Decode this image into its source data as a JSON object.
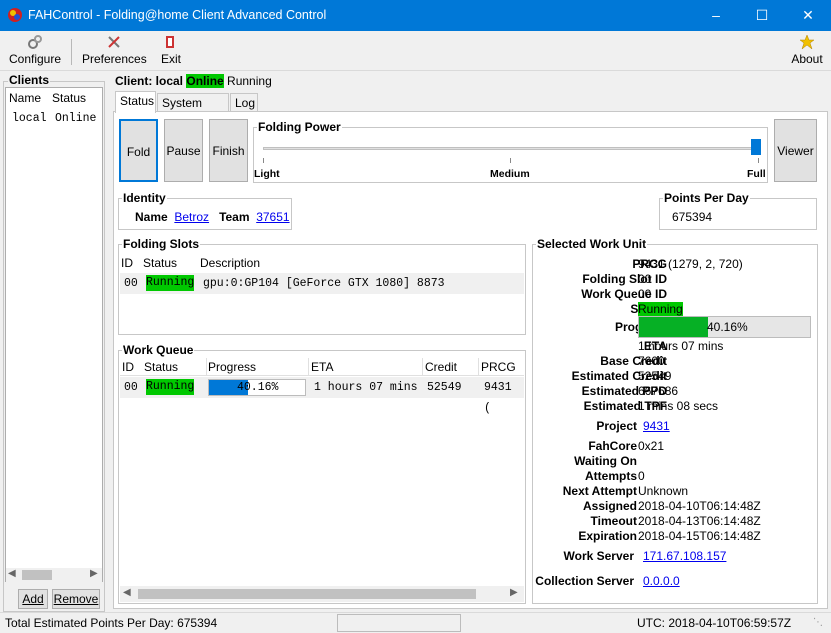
{
  "window": {
    "title": "FAHControl - Folding@home Client Advanced Control"
  },
  "toolbar": {
    "configure": "Configure",
    "preferences": "Preferences",
    "exit": "Exit",
    "about": "About"
  },
  "clients": {
    "title": "Clients",
    "col_name": "Name",
    "col_status": "Status",
    "rows": [
      {
        "name": "local",
        "status": "Online"
      }
    ],
    "add": "Add",
    "remove": "Remove"
  },
  "client_header": {
    "label": "Client: local",
    "status": "Online",
    "state": "Running"
  },
  "tabs": [
    "Status",
    "System Info",
    "Log"
  ],
  "controls": {
    "fold": "Fold",
    "pause": "Pause",
    "finish": "Finish",
    "viewer": "Viewer"
  },
  "folding_power": {
    "title": "Folding Power",
    "light": "Light",
    "medium": "Medium",
    "full": "Full",
    "level": 1.0
  },
  "identity": {
    "title": "Identity",
    "name_label": "Name",
    "name": "Betroz",
    "team_label": "Team",
    "team": "37651"
  },
  "ppd": {
    "title": "Points Per Day",
    "value": "675394"
  },
  "folding_slots": {
    "title": "Folding Slots",
    "headers": [
      "ID",
      "Status",
      "Description"
    ],
    "rows": [
      {
        "id": "00",
        "status": "Running",
        "description": "gpu:0:GP104 [GeForce GTX 1080] 8873"
      }
    ]
  },
  "work_queue": {
    "title": "Work Queue",
    "headers": [
      "ID",
      "Status",
      "Progress",
      "ETA",
      "Credit",
      "PRCG"
    ],
    "rows": [
      {
        "id": "00",
        "status": "Running",
        "progress": "40.16%",
        "progress_value": 0.4016,
        "eta": "1 hours 07 mins",
        "credit": "52549",
        "prcg": "9431 ("
      }
    ]
  },
  "selected_wu": {
    "title": "Selected Work Unit",
    "prcg_label": "PRCG",
    "prcg": "9431 (1279, 2, 720)",
    "slot_label": "Folding Slot ID",
    "slot": "00",
    "queue_label": "Work Queue ID",
    "queue": "00",
    "status_label": "Status",
    "status": "Running",
    "progress_label": "Progress",
    "progress": "40.16%",
    "progress_value": 0.4016,
    "eta_label": "ETA",
    "eta": "1 hours 07 mins",
    "base_credit_label": "Base Credit",
    "base_credit": "7600",
    "est_credit_label": "Estimated Credit",
    "est_credit": "52549",
    "est_ppd_label": "Estimated PPD",
    "est_ppd": "667686",
    "est_tpf_label": "Estimated TPF",
    "est_tpf": "1 mins 08 secs",
    "project_label": "Project",
    "project": "9431",
    "fahcore_label": "FahCore",
    "fahcore": "0x21",
    "waiting_label": "Waiting On",
    "waiting": "",
    "attempts_label": "Attempts",
    "attempts": "0",
    "next_attempt_label": "Next Attempt",
    "next_attempt": "Unknown",
    "assigned_label": "Assigned",
    "assigned": "2018-04-10T06:14:48Z",
    "timeout_label": "Timeout",
    "timeout": "2018-04-13T06:14:48Z",
    "expiration_label": "Expiration",
    "expiration": "2018-04-15T06:14:48Z",
    "work_server_label": "Work Server",
    "work_server": "171.67.108.157",
    "collection_server_label": "Collection Server",
    "collection_server": "0.0.0.0"
  },
  "statusbar": {
    "total": "Total Estimated Points Per Day: 675394",
    "utc": "UTC: 2018-04-10T06:59:57Z"
  }
}
